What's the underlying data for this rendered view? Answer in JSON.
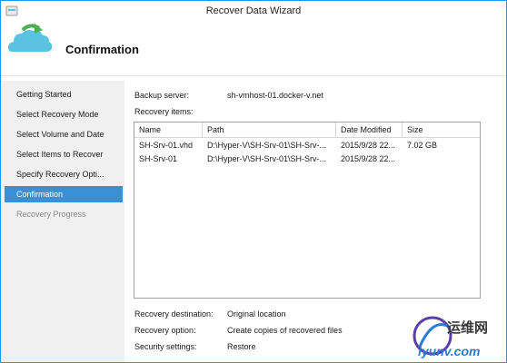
{
  "window": {
    "title": "Recover Data Wizard"
  },
  "header": {
    "heading": "Confirmation"
  },
  "nav": {
    "items": [
      {
        "label": "Getting Started"
      },
      {
        "label": "Select Recovery Mode"
      },
      {
        "label": "Select Volume and Date"
      },
      {
        "label": "Select Items to Recover"
      },
      {
        "label": "Specify Recovery Opti..."
      },
      {
        "label": "Confirmation"
      },
      {
        "label": "Recovery Progress"
      }
    ],
    "selected": "Confirmation"
  },
  "summary": {
    "backup_server_label": "Backup server:",
    "backup_server_value": "sh-vmhost-01.docker-v.net",
    "recovery_items_label": "Recovery items:"
  },
  "table": {
    "headers": [
      "Name",
      "Path",
      "Date Modified",
      "Size"
    ],
    "rows": [
      [
        "SH-Srv-01.vhd",
        "D:\\Hyper-V\\SH-Srv-01\\SH-Srv-...",
        "2015/9/28 22...",
        "7.02 GB"
      ],
      [
        "SH-Srv-01",
        "D:\\Hyper-V\\SH-Srv-01\\SH-Srv-...",
        "2015/9/28 22...",
        ""
      ]
    ]
  },
  "details": {
    "destination_label": "Recovery destination:",
    "destination_value": "Original location",
    "option_label": "Recovery option:",
    "option_value": "Create copies of recovered files",
    "security_label": "Security settings:",
    "security_value": "Restore"
  },
  "watermark": {
    "text_cn": "运维网",
    "text_url": "iyunv.com"
  },
  "colors": {
    "accent": "#3a8fd6",
    "icon_cloud": "#5bc3e0",
    "icon_arrow": "#4caf50"
  }
}
